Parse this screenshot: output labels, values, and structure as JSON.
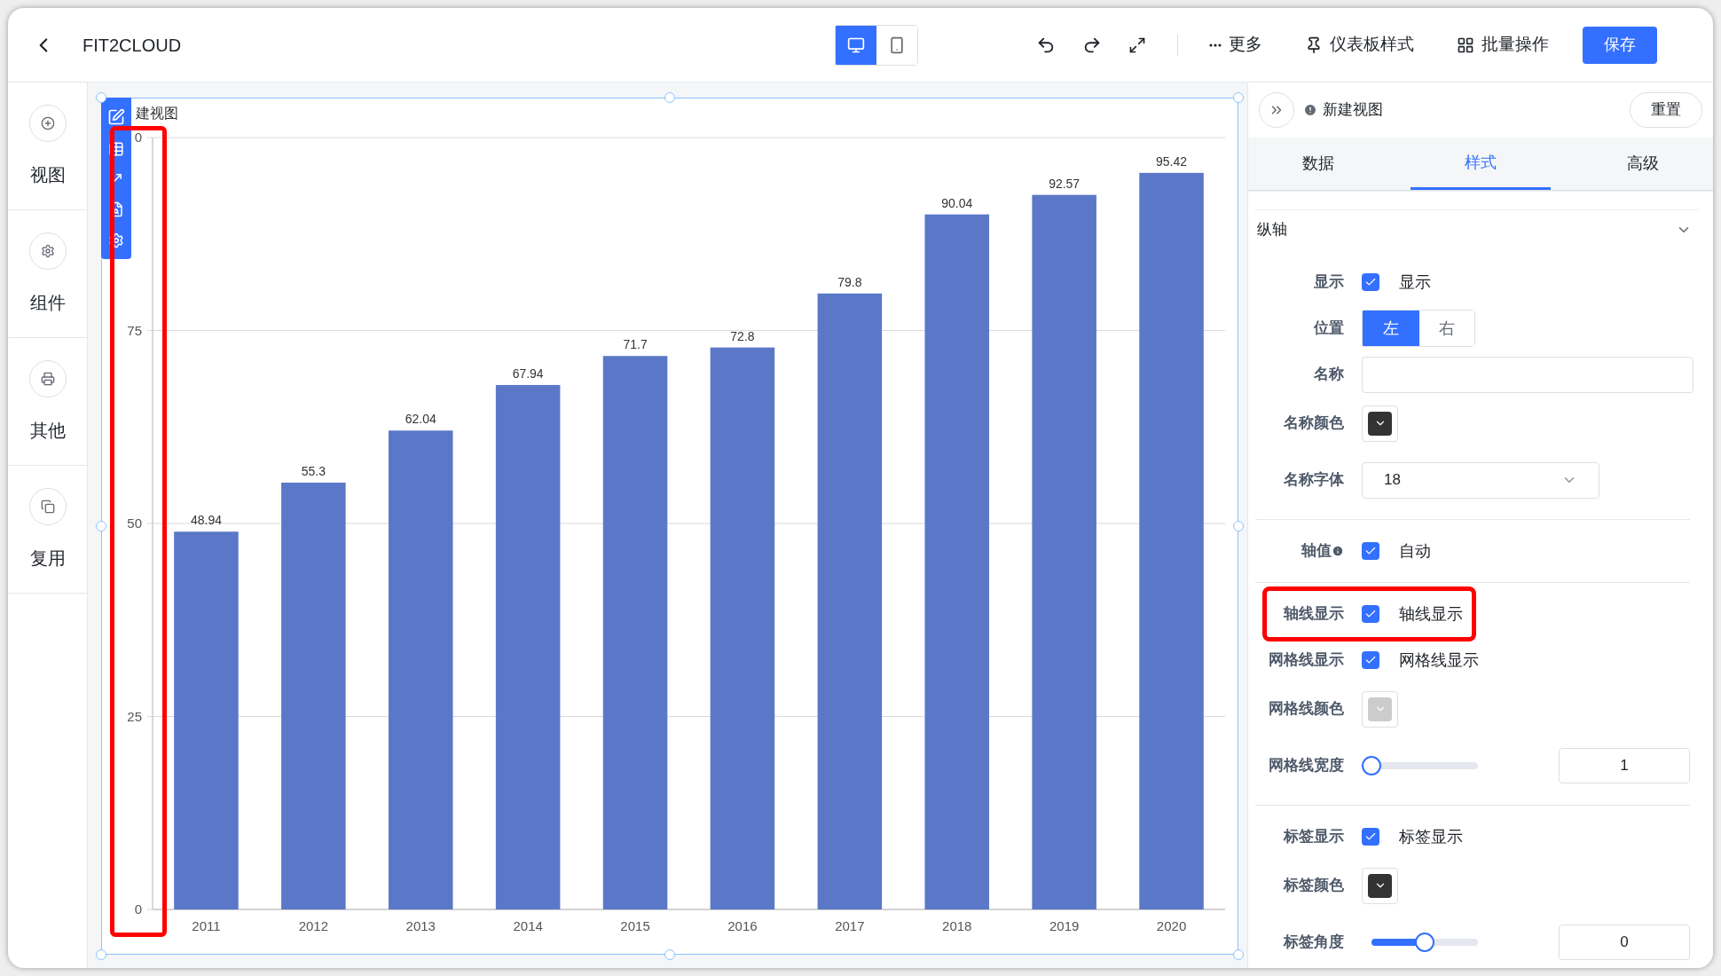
{
  "header": {
    "title": "FIT2CLOUD",
    "device_modes": [
      {
        "kind": "desktop",
        "selected": true
      },
      {
        "kind": "mobile",
        "selected": false
      }
    ],
    "actions": [
      {
        "kind": "more",
        "label": "更多"
      },
      {
        "kind": "style",
        "label": "仪表板样式"
      },
      {
        "kind": "batch",
        "label": "批量操作"
      }
    ],
    "save": "保存"
  },
  "sidebar": {
    "items": [
      {
        "kind": "view",
        "label": "视图"
      },
      {
        "kind": "component",
        "label": "组件"
      },
      {
        "kind": "other",
        "label": "其他"
      },
      {
        "kind": "reuse",
        "label": "复用"
      }
    ]
  },
  "chart": {
    "title": "建视图",
    "axis_highlighted": true,
    "top_tick_fragment": "0",
    "chart_data": {
      "type": "bar",
      "categories": [
        "2011",
        "2012",
        "2013",
        "2014",
        "2015",
        "2016",
        "2017",
        "2018",
        "2019",
        "2020"
      ],
      "series": [
        {
          "color": "#5b78c8",
          "values": [
            48.94,
            55.3,
            62.04,
            67.94,
            71.7,
            72.8,
            79.8,
            90.04,
            92.57,
            95.42
          ]
        }
      ],
      "ylim": [
        0,
        100
      ],
      "yticks": [
        0,
        25,
        50,
        75
      ],
      "grid": true,
      "data_labels": true
    }
  },
  "panel": {
    "title": "新建视图",
    "reset": "重置",
    "tabs": [
      {
        "label": "数据",
        "selected": false
      },
      {
        "label": "样式",
        "selected": true
      },
      {
        "label": "高级",
        "selected": false
      }
    ],
    "section": {
      "title": "纵轴",
      "expanded": true
    },
    "rows": [
      {
        "kind": "checkbox",
        "label": "显示",
        "checked": true,
        "text": "显示"
      },
      {
        "kind": "segmented",
        "label": "位置",
        "options": [
          {
            "label": "左",
            "selected": true
          },
          {
            "label": "右",
            "selected": false
          }
        ]
      },
      {
        "kind": "input",
        "label": "名称"
      },
      {
        "kind": "color",
        "label": "名称颜色",
        "color": "#333333"
      },
      {
        "kind": "select",
        "label": "名称字体",
        "value": "18"
      },
      {
        "kind": "divider"
      },
      {
        "kind": "checkbox",
        "label": "轴值",
        "info": true,
        "checked": true,
        "text": "自动"
      },
      {
        "kind": "divider"
      },
      {
        "kind": "checkbox",
        "label": "轴线显示",
        "checked": true,
        "text": "轴线显示",
        "highlighted": true
      },
      {
        "kind": "checkbox",
        "label": "网格线显示",
        "checked": true,
        "text": "网格线显示"
      },
      {
        "kind": "color",
        "label": "网格线颜色",
        "color": "#cccccc"
      },
      {
        "kind": "slider",
        "label": "网格线宽度",
        "level": 0,
        "value": "1"
      },
      {
        "kind": "divider"
      },
      {
        "kind": "checkbox",
        "label": "标签显示",
        "checked": true,
        "text": "标签显示"
      },
      {
        "kind": "color",
        "label": "标签颜色",
        "color": "#333333"
      },
      {
        "kind": "slider",
        "label": "标签角度",
        "level": 0.5,
        "value": "0"
      }
    ]
  }
}
